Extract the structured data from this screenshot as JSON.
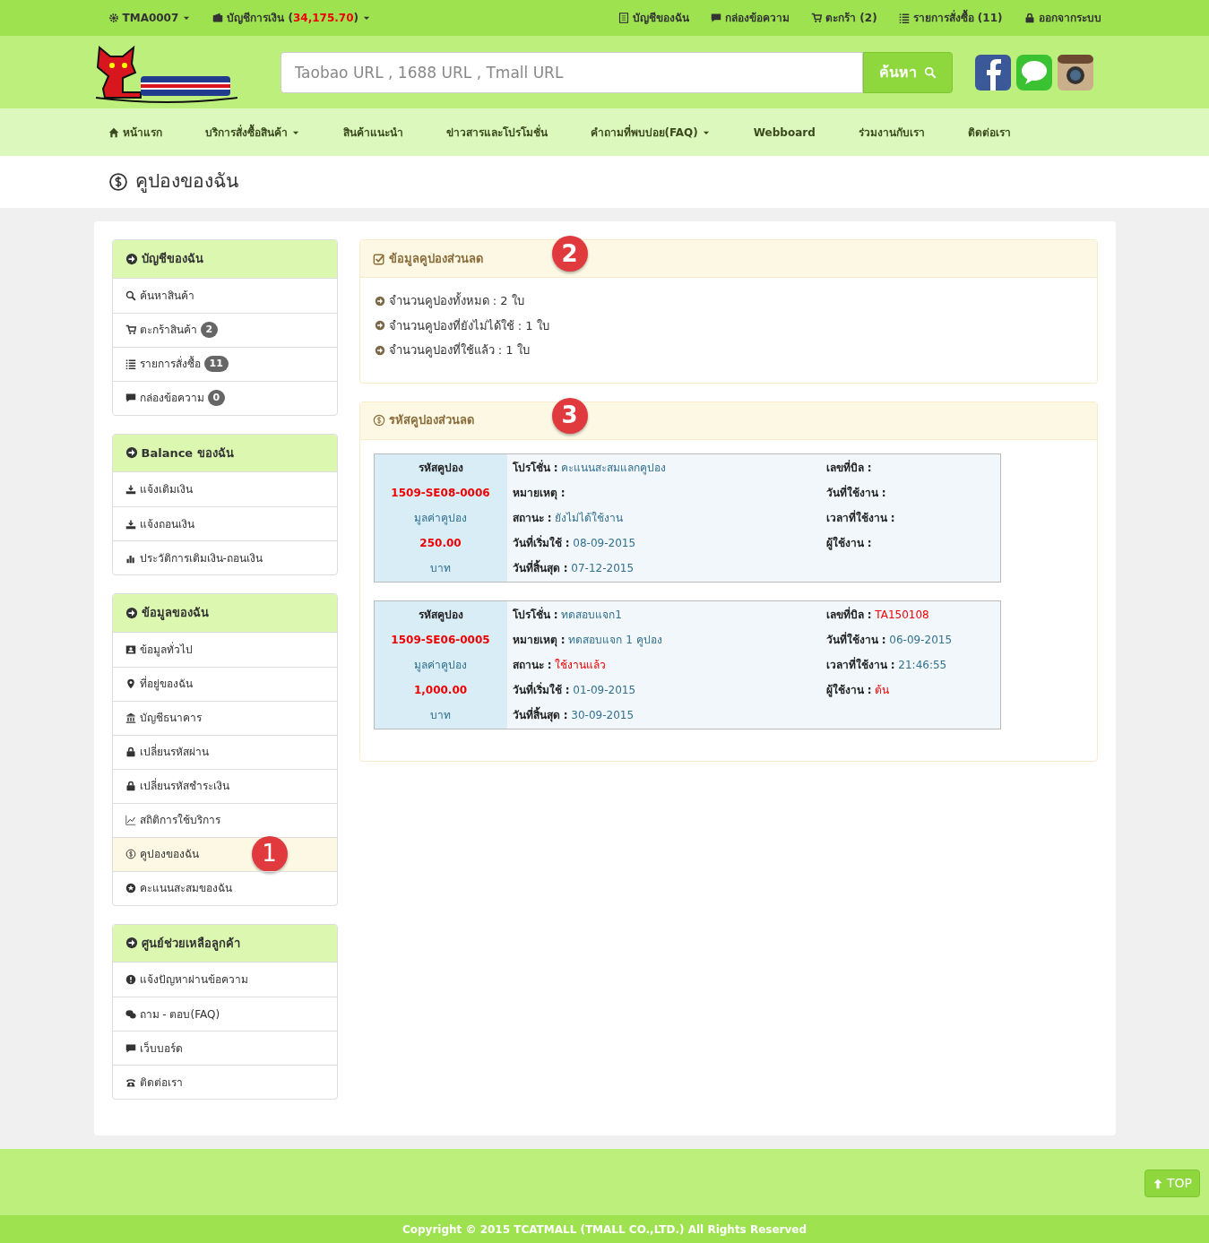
{
  "topbar": {
    "user": "TMA0007",
    "wallet_label": "บัญชีการเงิน (",
    "wallet_amount": "34,175.70",
    "wallet_suffix": ")",
    "links": [
      "บัญชีของฉัน",
      "กล่องข้อความ",
      "ตะกร้า (2)",
      "รายการสั่งซื้อ (11)",
      "ออกจากระบบ"
    ]
  },
  "search": {
    "placeholder": "Taobao URL , 1688 URL , Tmall URL",
    "button": "ค้นหา"
  },
  "nav": [
    {
      "label": "หน้าแรก",
      "dropdown": false
    },
    {
      "label": "บริการสั่งซื้อสินค้า",
      "dropdown": true
    },
    {
      "label": "สินค้าแนะนำ",
      "dropdown": false
    },
    {
      "label": "ข่าวสารและโปรโมชั่น",
      "dropdown": false
    },
    {
      "label": "คำถามที่พบบ่อย(FAQ)",
      "dropdown": true
    },
    {
      "label": "Webboard",
      "dropdown": false
    },
    {
      "label": "ร่วมงานกับเรา",
      "dropdown": false
    },
    {
      "label": "ติดต่อเรา",
      "dropdown": false
    }
  ],
  "page_title": "คูปองของฉัน",
  "sidebar": [
    {
      "title": "บัญชีของฉัน",
      "items": [
        {
          "label": "ค้นหาสินค้า",
          "selected": false
        },
        {
          "label": "ตะกร้าสินค้า",
          "count": "2",
          "selected": false
        },
        {
          "label": "รายการสั่งซื้อ",
          "count": "11",
          "selected": false
        },
        {
          "label": "กล่องข้อความ",
          "count": "0",
          "selected": false
        }
      ]
    },
    {
      "title": "Balance ของฉัน",
      "items": [
        {
          "label": "แจ้งเติมเงิน",
          "selected": false
        },
        {
          "label": "แจ้งถอนเงิน",
          "selected": false
        },
        {
          "label": "ประวัติการเติมเงิน-ถอนเงิน",
          "selected": false
        }
      ]
    },
    {
      "title": "ข้อมูลของฉัน",
      "items": [
        {
          "label": "ข้อมูลทั่วไป",
          "selected": false
        },
        {
          "label": "ที่อยู่ของฉัน",
          "selected": false
        },
        {
          "label": "บัญชีธนาคาร",
          "selected": false
        },
        {
          "label": "เปลี่ยนรหัสผ่าน",
          "selected": false
        },
        {
          "label": "เปลี่ยนรหัสชำระเงิน",
          "selected": false
        },
        {
          "label": "สถิติการใช้บริการ",
          "selected": false
        },
        {
          "label": "คูปองของฉัน",
          "selected": true,
          "marker": "1"
        },
        {
          "label": "คะแนนสะสมของฉัน",
          "selected": false
        }
      ]
    },
    {
      "title": "ศูนย์ช่วยเหลือลูกค้า",
      "items": [
        {
          "label": "แจ้งปัญหาผ่านข้อความ",
          "selected": false
        },
        {
          "label": "ถาม - ตอบ(FAQ)",
          "selected": false
        },
        {
          "label": "เว็บบอร์ด",
          "selected": false
        },
        {
          "label": "ติดต่อเรา",
          "selected": false
        }
      ]
    }
  ],
  "summary": {
    "title": "ข้อมูลคูปองส่วนลด",
    "marker": "2",
    "lines": [
      "จำนวนคูปองทั้งหมด : 2 ใบ",
      "จำนวนคูปองที่ยังไม่ได้ใช้ : 1 ใบ",
      "จำนวนคูปองที่ใช้แล้ว : 1 ใบ"
    ]
  },
  "coupons_panel": {
    "title": "รหัสคูปองส่วนลด",
    "marker": "3",
    "coupons": [
      {
        "code_label": "รหัสคูปอง",
        "code": "1509-SE08-0006",
        "value_label": "มูลค่าคูปอง",
        "value": "250.00",
        "unit": "บาท",
        "left": [
          {
            "label": "โปรโชั่น :",
            "value": "คะแนนสะสมแลกคูปอง",
            "alert": false
          },
          {
            "label": "หมายเหตุ :"
          },
          {
            "label": "สถานะ :",
            "value": "ยังไม่ได้ใช้งาน",
            "alert": false
          },
          {
            "label": "วันที่เริ่มใช้ :",
            "value": "08-09-2015",
            "alert": false
          },
          {
            "label": "วันที่สิ้นสุด :",
            "value": "07-12-2015",
            "alert": false
          }
        ],
        "right": [
          {
            "label": "เลขที่บิล :"
          },
          {
            "label": "วันที่ใช้งาน :"
          },
          {
            "label": "เวลาที่ใช้งาน :"
          },
          {
            "label": "ผู้ใช้งาน :"
          }
        ]
      },
      {
        "code_label": "รหัสคูปอง",
        "code": "1509-SE06-0005",
        "value_label": "มูลค่าคูปอง",
        "value": "1,000.00",
        "unit": "บาท",
        "left": [
          {
            "label": "โปรโชั่น :",
            "value": "ทดสอบแจก1",
            "alert": false
          },
          {
            "label": "หมายเหตุ :",
            "value": "ทดสอบแจก 1 คูปอง",
            "alert": false
          },
          {
            "label": "สถานะ :",
            "value": "ใช้งานแล้ว",
            "alert": true
          },
          {
            "label": "วันที่เริ่มใช้ :",
            "value": "01-09-2015",
            "alert": false
          },
          {
            "label": "วันที่สิ้นสุด :",
            "value": "30-09-2015",
            "alert": false
          }
        ],
        "right": [
          {
            "label": "เลขที่บิล :",
            "value": "TA150108",
            "alert": true
          },
          {
            "label": "วันที่ใช้งาน :",
            "value": "06-09-2015",
            "alert": false
          },
          {
            "label": "เวลาที่ใช้งาน :",
            "value": "21:46:55",
            "alert": false
          },
          {
            "label": "ผู้ใช้งาน :",
            "value": "ต้น",
            "alert": true
          }
        ]
      }
    ]
  },
  "top_button": "TOP",
  "footer": "Copyright © 2015 TCATMALL (TMALL CO.,LTD.) All Rights Reserved"
}
